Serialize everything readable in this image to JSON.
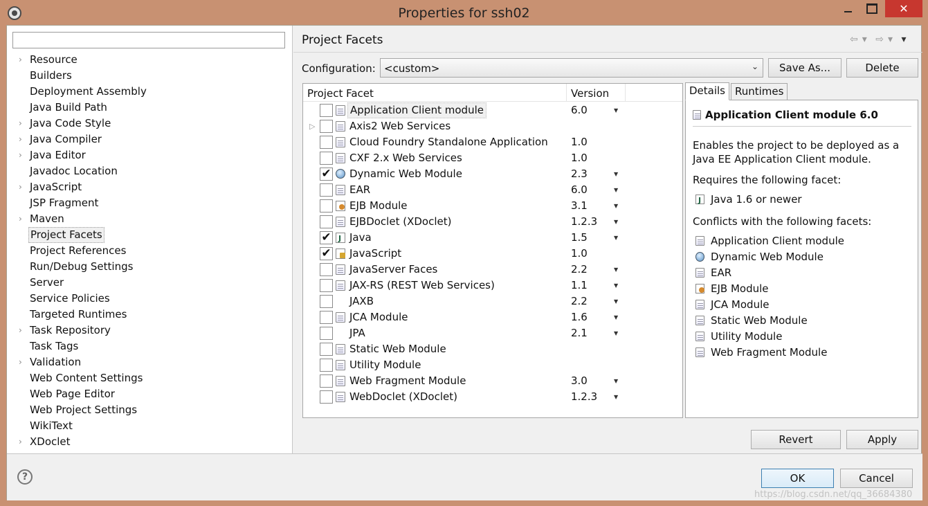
{
  "window": {
    "title": "Properties for ssh02",
    "close_glyph": "✕"
  },
  "filter": {
    "value": "",
    "placeholder": ""
  },
  "tree": {
    "items": [
      {
        "label": "Resource",
        "expandable": true
      },
      {
        "label": "Builders",
        "expandable": false
      },
      {
        "label": "Deployment Assembly",
        "expandable": false
      },
      {
        "label": "Java Build Path",
        "expandable": false
      },
      {
        "label": "Java Code Style",
        "expandable": true
      },
      {
        "label": "Java Compiler",
        "expandable": true
      },
      {
        "label": "Java Editor",
        "expandable": true
      },
      {
        "label": "Javadoc Location",
        "expandable": false
      },
      {
        "label": "JavaScript",
        "expandable": true
      },
      {
        "label": "JSP Fragment",
        "expandable": false
      },
      {
        "label": "Maven",
        "expandable": true
      },
      {
        "label": "Project Facets",
        "expandable": false,
        "selected": true
      },
      {
        "label": "Project References",
        "expandable": false
      },
      {
        "label": "Run/Debug Settings",
        "expandable": false
      },
      {
        "label": "Server",
        "expandable": false
      },
      {
        "label": "Service Policies",
        "expandable": false
      },
      {
        "label": "Targeted Runtimes",
        "expandable": false
      },
      {
        "label": "Task Repository",
        "expandable": true
      },
      {
        "label": "Task Tags",
        "expandable": false
      },
      {
        "label": "Validation",
        "expandable": true
      },
      {
        "label": "Web Content Settings",
        "expandable": false
      },
      {
        "label": "Web Page Editor",
        "expandable": false
      },
      {
        "label": "Web Project Settings",
        "expandable": false
      },
      {
        "label": "WikiText",
        "expandable": false
      },
      {
        "label": "XDoclet",
        "expandable": true
      }
    ],
    "arrow_glyph": "›"
  },
  "page": {
    "title": "Project Facets",
    "nav": {
      "back": "⇦",
      "forward": "⇨",
      "menu": "▾"
    },
    "config_label": "Configuration:",
    "config_value": "<custom>",
    "combo_arrow": "⌄",
    "save_as": "Save As...",
    "delete": "Delete",
    "revert": "Revert",
    "apply": "Apply"
  },
  "facets": {
    "col_facet": "Project Facet",
    "col_version": "Version",
    "dd_glyph": "▼",
    "expand_glyph": "▷",
    "check_glyph": "✔",
    "rows": [
      {
        "name": "Application Client module",
        "version": "6.0",
        "checked": false,
        "dd": true,
        "icon": "page",
        "selected": true,
        "expand": false
      },
      {
        "name": "Axis2 Web Services",
        "version": "",
        "checked": false,
        "dd": false,
        "icon": "page",
        "expand": true
      },
      {
        "name": "Cloud Foundry Standalone Application",
        "version": "1.0",
        "checked": false,
        "dd": false,
        "icon": "page",
        "expand": false
      },
      {
        "name": "CXF 2.x Web Services",
        "version": "1.0",
        "checked": false,
        "dd": false,
        "icon": "page",
        "expand": false
      },
      {
        "name": "Dynamic Web Module",
        "version": "2.3",
        "checked": true,
        "dd": true,
        "icon": "globe",
        "expand": false
      },
      {
        "name": "EAR",
        "version": "6.0",
        "checked": false,
        "dd": true,
        "icon": "page",
        "expand": false
      },
      {
        "name": "EJB Module",
        "version": "3.1",
        "checked": false,
        "dd": true,
        "icon": "bean",
        "expand": false
      },
      {
        "name": "EJBDoclet (XDoclet)",
        "version": "1.2.3",
        "checked": false,
        "dd": true,
        "icon": "page",
        "expand": false
      },
      {
        "name": "Java",
        "version": "1.5",
        "checked": true,
        "dd": true,
        "icon": "java",
        "expand": false
      },
      {
        "name": "JavaScript",
        "version": "1.0",
        "checked": true,
        "dd": false,
        "icon": "js",
        "expand": false
      },
      {
        "name": "JavaServer Faces",
        "version": "2.2",
        "checked": false,
        "dd": true,
        "icon": "page",
        "expand": false
      },
      {
        "name": "JAX-RS (REST Web Services)",
        "version": "1.1",
        "checked": false,
        "dd": true,
        "icon": "page",
        "expand": false
      },
      {
        "name": "JAXB",
        "version": "2.2",
        "checked": false,
        "dd": true,
        "icon": "xml",
        "expand": false
      },
      {
        "name": "JCA Module",
        "version": "1.6",
        "checked": false,
        "dd": true,
        "icon": "page",
        "expand": false
      },
      {
        "name": "JPA",
        "version": "2.1",
        "checked": false,
        "dd": true,
        "icon": "xml",
        "expand": false
      },
      {
        "name": "Static Web Module",
        "version": "",
        "checked": false,
        "dd": false,
        "icon": "page",
        "expand": false
      },
      {
        "name": "Utility Module",
        "version": "",
        "checked": false,
        "dd": false,
        "icon": "page",
        "expand": false
      },
      {
        "name": "Web Fragment Module",
        "version": "3.0",
        "checked": false,
        "dd": true,
        "icon": "page",
        "expand": false
      },
      {
        "name": "WebDoclet (XDoclet)",
        "version": "1.2.3",
        "checked": false,
        "dd": true,
        "icon": "page",
        "expand": false
      }
    ]
  },
  "details": {
    "tab_details": "Details",
    "tab_runtimes": "Runtimes",
    "title": "Application Client module 6.0",
    "desc_line1": "Enables the project to be deployed as a",
    "desc_line2": "Java EE Application Client module.",
    "requires_label": "Requires the following facet:",
    "requires": [
      {
        "name": "Java 1.6 or newer",
        "icon": "java"
      }
    ],
    "conflicts_label": "Conflicts with the following facets:",
    "conflicts": [
      {
        "name": "Application Client module",
        "icon": "page"
      },
      {
        "name": "Dynamic Web Module",
        "icon": "globe"
      },
      {
        "name": "EAR",
        "icon": "page"
      },
      {
        "name": "EJB Module",
        "icon": "bean"
      },
      {
        "name": "JCA Module",
        "icon": "page"
      },
      {
        "name": "Static Web Module",
        "icon": "page"
      },
      {
        "name": "Utility Module",
        "icon": "page"
      },
      {
        "name": "Web Fragment Module",
        "icon": "page"
      }
    ]
  },
  "footer": {
    "help": "?",
    "ok": "OK",
    "cancel": "Cancel",
    "watermark": "https://blog.csdn.net/qq_36684380"
  }
}
